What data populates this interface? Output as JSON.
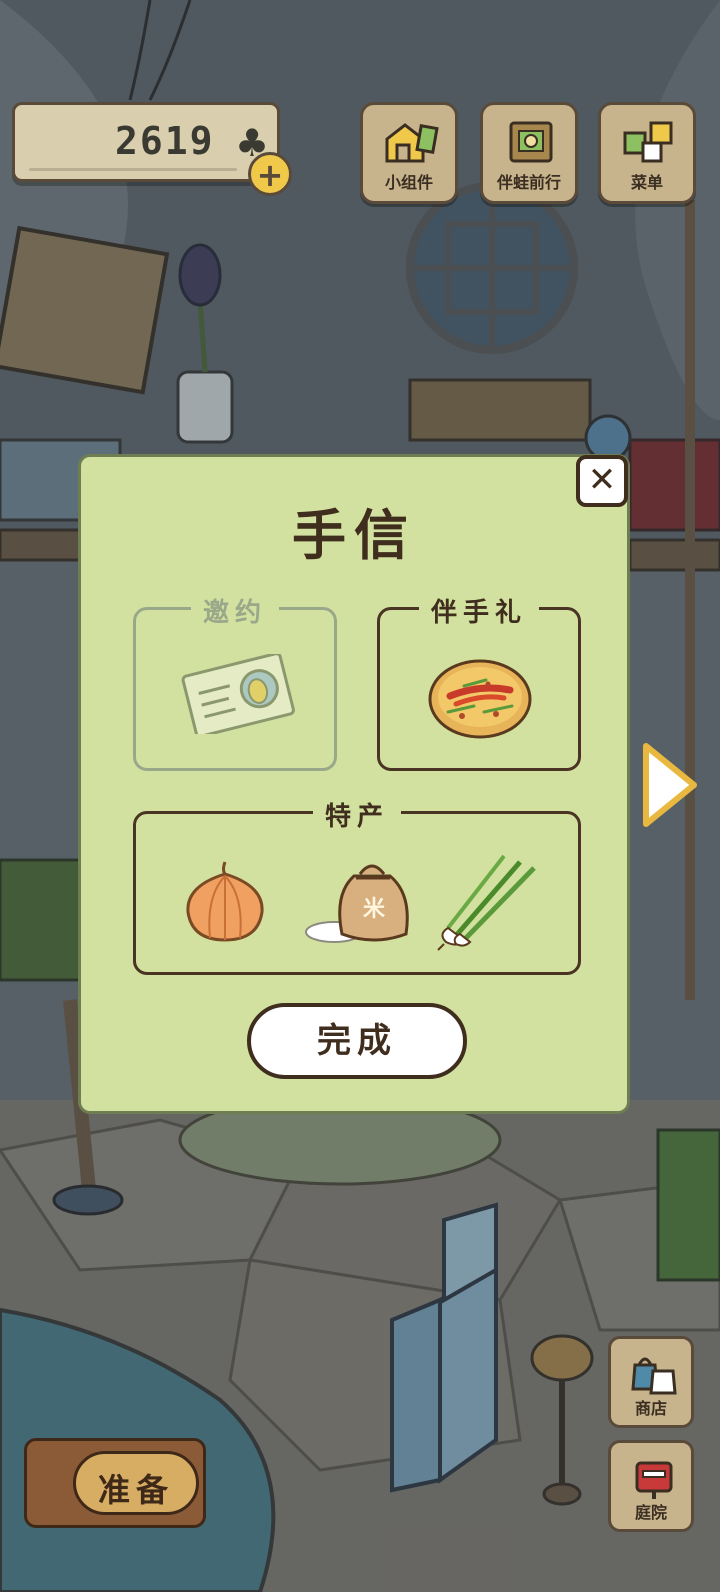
{
  "hud": {
    "clover_count": "2619",
    "clover_icon": "clover-icon",
    "add_icon": "plus-icon",
    "add_symbol": "+"
  },
  "top_buttons": [
    {
      "label": "小组件",
      "icon": "widget-icon"
    },
    {
      "label": "伴蛙前行",
      "icon": "book-icon"
    },
    {
      "label": "菜单",
      "icon": "menu-icon"
    }
  ],
  "side_buttons": [
    {
      "label": "商店",
      "icon": "shop-bags-icon"
    },
    {
      "label": "庭院",
      "icon": "mailbox-icon"
    }
  ],
  "prepare_label": "准备",
  "dialog": {
    "title": "手信",
    "close_symbol": "✕",
    "slots": {
      "invitation": {
        "label": "邀约",
        "enabled": false,
        "items": [
          "invitation-card-icon"
        ]
      },
      "gift": {
        "label": "伴手礼",
        "enabled": true,
        "items": [
          "pancake-icon"
        ]
      },
      "specialty": {
        "label": "特产",
        "enabled": true,
        "items": [
          "onion-icon",
          "rice-bag-icon",
          "green-onion-icon"
        ]
      }
    },
    "rice_bag_mark": "米",
    "done_label": "完成"
  },
  "colors": {
    "dialog_bg": "#d2e1a0",
    "dark_brown": "#3f2d1e",
    "wood": "#c8b48c"
  }
}
